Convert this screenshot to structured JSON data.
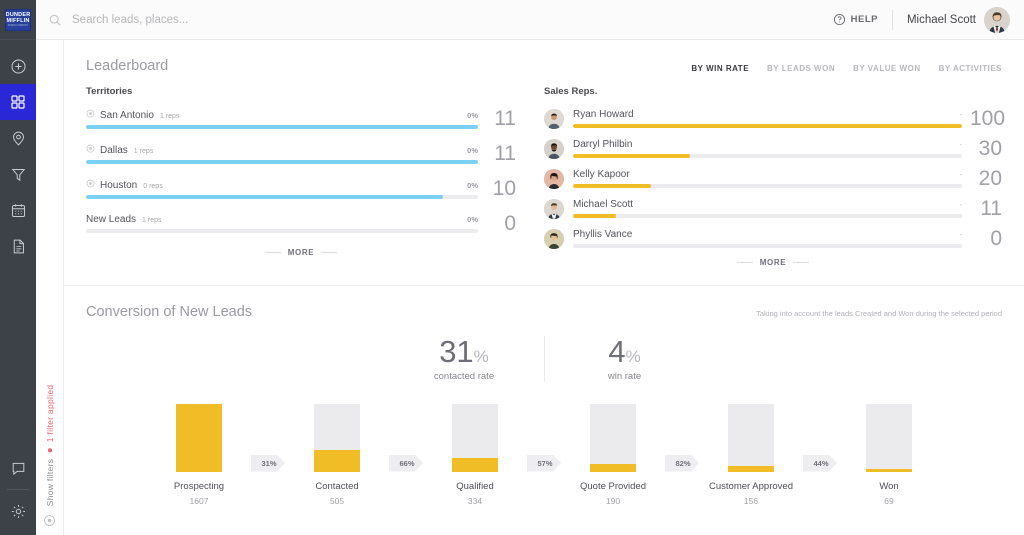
{
  "brand": {
    "logo_line1": "DUNDER",
    "logo_line2": "MIFFLIN",
    "logo_sub": "PAPER COMPANY"
  },
  "sidebar": {
    "items": [
      {
        "icon": "plus-circle-icon",
        "name": "add"
      },
      {
        "icon": "grid-dashboard-icon",
        "name": "dashboard",
        "active": true
      },
      {
        "icon": "location-pin-icon",
        "name": "map"
      },
      {
        "icon": "funnel-filter-icon",
        "name": "pipeline"
      },
      {
        "icon": "calendar-icon",
        "name": "calendar"
      },
      {
        "icon": "document-icon",
        "name": "reports"
      }
    ],
    "bottom_items": [
      {
        "icon": "chat-bubble-icon",
        "name": "messages"
      },
      {
        "icon": "gear-icon",
        "name": "settings"
      }
    ]
  },
  "header": {
    "search_placeholder": "Search leads, places...",
    "search_value": "",
    "help_label": "HELP",
    "user_name": "Michael Scott"
  },
  "filter_rail": {
    "show_filters": "Show filters",
    "applied": "1 filter applied",
    "separator": "•"
  },
  "leaderboard": {
    "title": "Leaderboard",
    "tabs": [
      {
        "label": "BY WIN RATE",
        "active": true
      },
      {
        "label": "BY LEADS WON",
        "active": false
      },
      {
        "label": "BY VALUE WON",
        "active": false
      },
      {
        "label": "BY ACTIVITIES",
        "active": false
      }
    ],
    "territories_heading": "Territories",
    "reps_heading": "Sales Reps.",
    "more_label": "MORE",
    "territories": [
      {
        "name": "San Antonio",
        "reps": "1 reps",
        "pct": "0%",
        "value": "11",
        "bar": 100,
        "has_icon": true
      },
      {
        "name": "Dallas",
        "reps": "1 reps",
        "pct": "0%",
        "value": "11",
        "bar": 100,
        "has_icon": true
      },
      {
        "name": "Houston",
        "reps": "0 reps",
        "pct": "0%",
        "value": "10",
        "bar": 91,
        "has_icon": true
      },
      {
        "name": "New Leads",
        "reps": "1 reps",
        "pct": "0%",
        "value": "0",
        "bar": 0,
        "has_icon": false
      }
    ],
    "reps": [
      {
        "name": "Ryan Howard",
        "pct": "-",
        "value": "100",
        "bar": 100,
        "avatar": "#8a7a66"
      },
      {
        "name": "Darryl Philbin",
        "pct": "-",
        "value": "30",
        "bar": 30,
        "avatar": "#6b5c4c"
      },
      {
        "name": "Kelly Kapoor",
        "pct": "-",
        "value": "20",
        "bar": 20,
        "avatar": "#b07b6b"
      },
      {
        "name": "Michael Scott",
        "pct": "-",
        "value": "11",
        "bar": 11,
        "avatar": "#7b6a58"
      },
      {
        "name": "Phyllis Vance",
        "pct": "-",
        "value": "0",
        "bar": 0,
        "avatar": "#6f6a4f"
      }
    ]
  },
  "conversion": {
    "title": "Conversion of New Leads",
    "note": "Taking into account the leads Created and Won during the selected period",
    "rates": [
      {
        "number": "31",
        "unit": "%",
        "label": "contacted rate"
      },
      {
        "number": "4",
        "unit": "%",
        "label": "win rate"
      }
    ]
  },
  "chart_data": {
    "type": "bar",
    "title": "Conversion of New Leads",
    "subtitle": "Taking into account the leads Created and Won during the selected period",
    "categories": [
      "Prospecting",
      "Contacted",
      "Qualified",
      "Quote Provided",
      "Customer Approved",
      "Won"
    ],
    "values": [
      1607,
      505,
      334,
      190,
      156,
      69
    ],
    "value_labels": [
      "1607",
      "505",
      "334",
      "190",
      "156",
      "69"
    ],
    "fill_pct_of_track": [
      100,
      31,
      20,
      11,
      8,
      4
    ],
    "conversion_steps": [
      "31%",
      "66%",
      "57%",
      "82%",
      "44%"
    ],
    "summary_metrics": [
      {
        "label": "contacted rate",
        "value": 31,
        "unit": "%"
      },
      {
        "label": "win rate",
        "value": 4,
        "unit": "%"
      }
    ],
    "xlabel": "",
    "ylabel": "",
    "grid": false,
    "legend": "none",
    "colors": {
      "fill": "#f0bd26",
      "track": "#ebebed"
    }
  },
  "colors": {
    "rail": "#3d4249",
    "accent_blue": "#2a28d6",
    "logo_blue": "#27409b",
    "bar_blue": "#7ad0f5",
    "bar_gold": "#f0bd26",
    "track_gray": "#ececee",
    "filter_red": "#e8616b"
  }
}
